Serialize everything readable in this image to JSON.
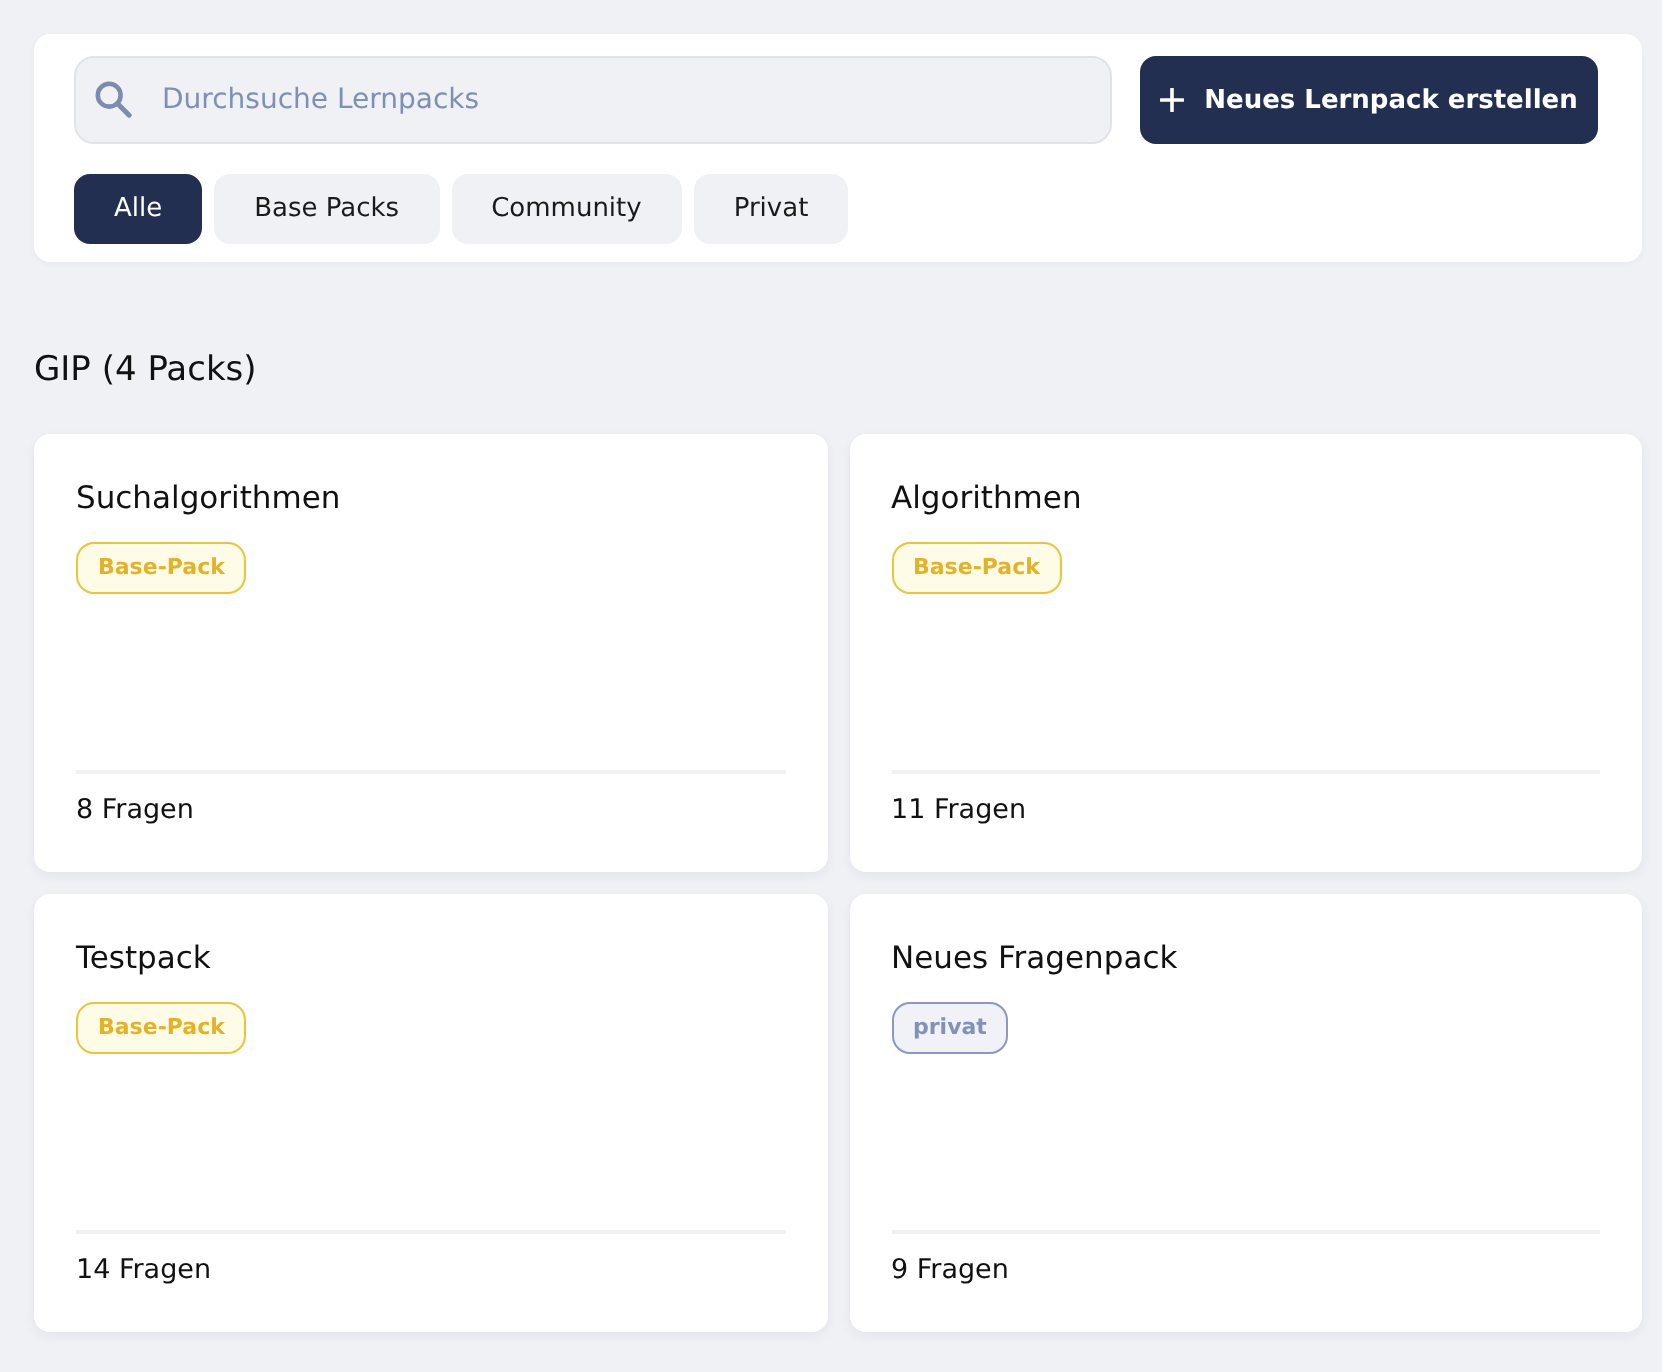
{
  "search": {
    "placeholder": "Durchsuche Lernpacks"
  },
  "create_button": {
    "label": "Neues Lernpack erstellen"
  },
  "filters": [
    {
      "label": "Alle",
      "selected": true
    },
    {
      "label": "Base Packs",
      "selected": false
    },
    {
      "label": "Community",
      "selected": false
    },
    {
      "label": "Privat",
      "selected": false
    }
  ],
  "section": {
    "title": "GIP (4 Packs)"
  },
  "packs": [
    {
      "title": "Suchalgorithmen",
      "badge": {
        "label": "Base-Pack",
        "kind": "base"
      },
      "count": "8 Fragen"
    },
    {
      "title": "Algorithmen",
      "badge": {
        "label": "Base-Pack",
        "kind": "base"
      },
      "count": "11 Fragen"
    },
    {
      "title": "Testpack",
      "badge": {
        "label": "Base-Pack",
        "kind": "base"
      },
      "count": "14 Fragen"
    },
    {
      "title": "Neues Fragenpack",
      "badge": {
        "label": "privat",
        "kind": "private"
      },
      "count": "9 Fragen"
    }
  ]
}
